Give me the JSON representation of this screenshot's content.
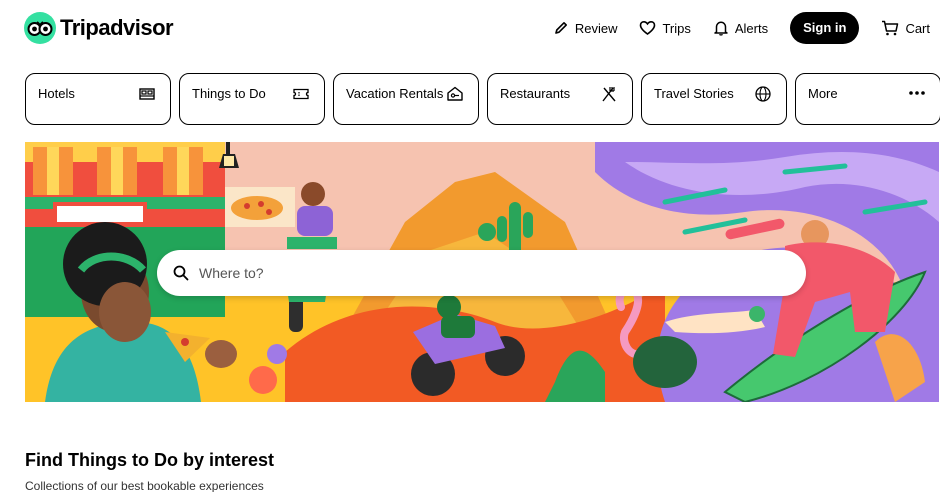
{
  "brand": {
    "name": "Tripadvisor",
    "accent": "#34e0a1"
  },
  "nav": {
    "review": "Review",
    "trips": "Trips",
    "alerts": "Alerts",
    "signin": "Sign in",
    "cart": "Cart"
  },
  "tabs": [
    {
      "label": "Hotels",
      "icon": "bed-icon"
    },
    {
      "label": "Things to Do",
      "icon": "ticket-icon"
    },
    {
      "label": "Vacation Rentals",
      "icon": "house-key-icon"
    },
    {
      "label": "Restaurants",
      "icon": "fork-knife-icon"
    },
    {
      "label": "Travel Stories",
      "icon": "globe-icon"
    },
    {
      "label": "More",
      "icon": "more-dots-icon"
    }
  ],
  "search": {
    "placeholder": "Where to?"
  },
  "section": {
    "title": "Find Things to Do by interest",
    "subtitle": "Collections of our best bookable experiences"
  }
}
